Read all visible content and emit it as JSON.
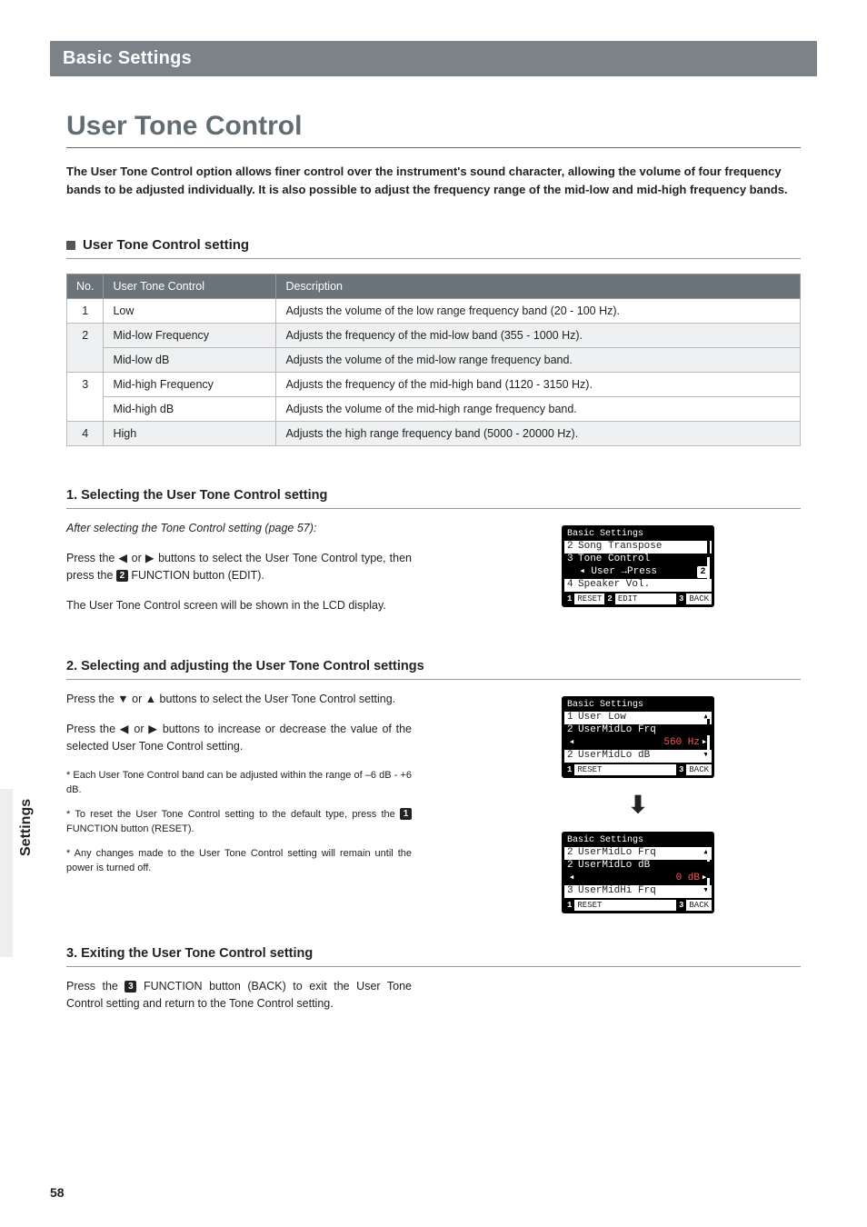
{
  "side_label": "Settings",
  "page_number": "58",
  "banner": "Basic Settings",
  "title": "User Tone Control",
  "intro": "The User Tone Control option allows finer control over the instrument's sound character, allowing the volume of four frequency bands to be adjusted individually.  It is also possible to adjust the frequency range of the mid-low and mid-high frequency bands.",
  "sub1": "User Tone Control setting",
  "table": {
    "head": {
      "no": "No.",
      "utc": "User Tone Control",
      "desc": "Description"
    },
    "rows": [
      {
        "no": "1",
        "utc": "Low",
        "desc": "Adjusts the volume of the low range frequency band (20 - 100 Hz)."
      },
      {
        "no": "2",
        "utc": "Mid-low Frequency",
        "desc": "Adjusts the frequency of the mid-low band (355 - 1000 Hz)."
      },
      {
        "no": "",
        "utc": "Mid-low dB",
        "desc": "Adjusts the volume of the mid-low range frequency band."
      },
      {
        "no": "3",
        "utc": "Mid-high Frequency",
        "desc": "Adjusts the frequency of the mid-high band (1120 - 3150 Hz)."
      },
      {
        "no": "",
        "utc": "Mid-high dB",
        "desc": "Adjusts the volume of the mid-high range frequency band."
      },
      {
        "no": "4",
        "utc": "High",
        "desc": "Adjusts the high range frequency band (5000 - 20000 Hz)."
      }
    ]
  },
  "step1": {
    "head": "1. Selecting the User Tone Control setting",
    "ital": "After selecting the Tone Control setting (page 57):",
    "p1a": "Press the ◀ or ▶ buttons to select the User Tone Control type, then press the ",
    "p1n": "2",
    "p1b": " FUNCTION button (EDIT).",
    "p2": "The User Tone Control screen will be shown in the LCD display."
  },
  "step2": {
    "head": "2. Selecting and adjusting the User Tone Control settings",
    "p1": "Press the ▼ or ▲ buttons to select the User Tone Control setting.",
    "p2": "Press the ◀ or ▶ buttons to increase or decrease the value of the selected User Tone Control setting.",
    "n1": "* Each User Tone Control band can be adjusted within the range of –6 dB - +6 dB.",
    "n2a": "* To reset the User Tone Control setting to the default type, press the ",
    "n2n": "1",
    "n2b": " FUNCTION button (RESET).",
    "n3": "* Any changes made to the User Tone Control setting will remain until the power is turned off."
  },
  "step3": {
    "head": "3. Exiting the User Tone Control setting",
    "p1a": "Press the ",
    "p1n": "3",
    "p1b": " FUNCTION button (BACK) to exit the User Tone Control setting and return to the Tone Control setting."
  },
  "lcd1": {
    "hdr": "Basic Settings",
    "r1": {
      "n": "2",
      "t": "Song Transpose"
    },
    "r2": {
      "n": "3",
      "t": "Tone Control"
    },
    "r2b": {
      "t": "  ◂ User →Press",
      "v": "2"
    },
    "r3": {
      "n": "4",
      "t": "Speaker Vol."
    },
    "soft": {
      "k1": "1",
      "l1": "RESET",
      "k2": "2",
      "l2": "EDIT",
      "k3": "3",
      "l3": "BACK"
    }
  },
  "lcd2": {
    "hdr": "Basic Settings",
    "r1": {
      "n": "1",
      "t": "User Low"
    },
    "r2": {
      "n": "2",
      "t": "UserMidLo Frq"
    },
    "r2b": {
      "l": "◂",
      "v": "560 Hz",
      "r": "▸"
    },
    "r3": {
      "n": "2",
      "t": "UserMidLo dB"
    },
    "soft": {
      "k1": "1",
      "l1": "RESET",
      "k3": "3",
      "l3": "BACK"
    }
  },
  "lcd3": {
    "hdr": "Basic Settings",
    "r1": {
      "n": "2",
      "t": "UserMidLo Frq"
    },
    "r2": {
      "n": "2",
      "t": "UserMidLo dB"
    },
    "r2b": {
      "l": "◂",
      "v": "0 dB",
      "r": "▸"
    },
    "r3": {
      "n": "3",
      "t": "UserMidHi Frq"
    },
    "soft": {
      "k1": "1",
      "l1": "RESET",
      "k3": "3",
      "l3": "BACK"
    }
  },
  "darrow": "⬇"
}
